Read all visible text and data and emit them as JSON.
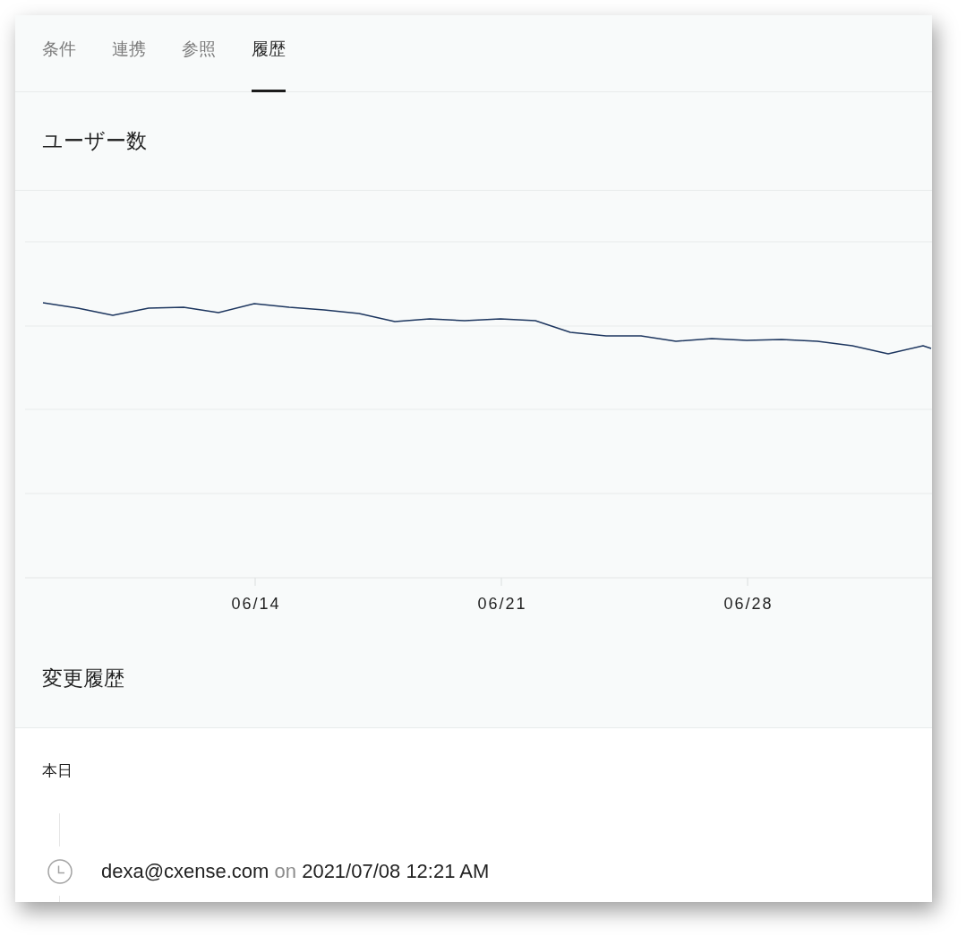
{
  "tabs": [
    {
      "label": "条件",
      "selected": false
    },
    {
      "label": "連携",
      "selected": false
    },
    {
      "label": "参照",
      "selected": false
    },
    {
      "label": "履歴",
      "selected": true
    }
  ],
  "user_chart": {
    "title": "ユーザー数",
    "x_labels": [
      "06/14",
      "06/21",
      "06/28"
    ]
  },
  "history": {
    "title": "変更履歴",
    "groups": [
      {
        "label": "本日",
        "entries": [
          {
            "user": "dexa@cxense.com",
            "connector": "on",
            "timestamp": "2021/07/08 12:21 AM"
          }
        ]
      }
    ]
  }
}
